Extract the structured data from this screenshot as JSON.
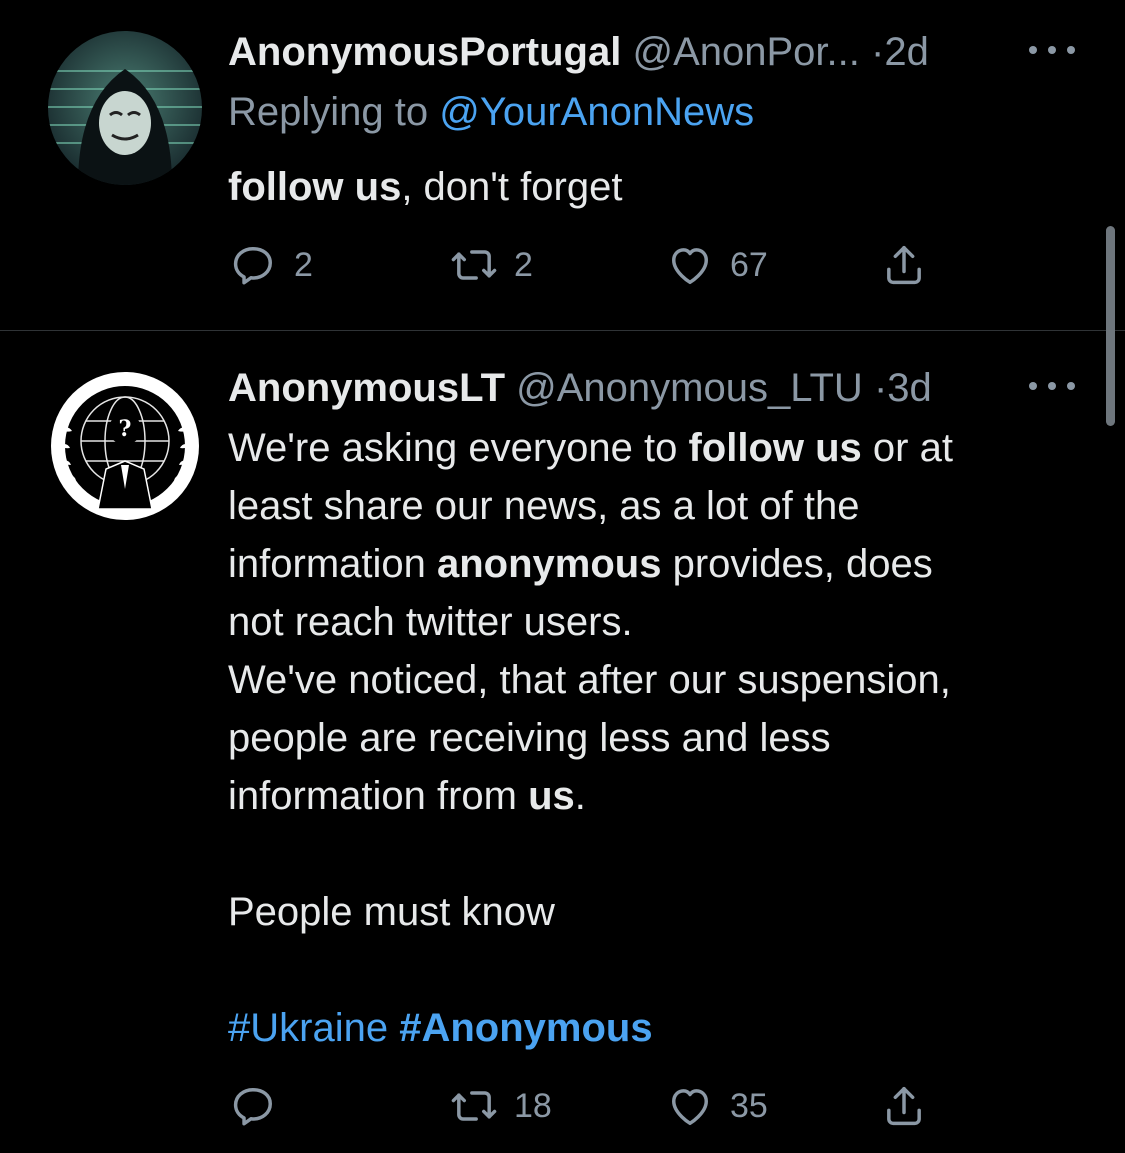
{
  "tweets": [
    {
      "name": "AnonymousPortugal",
      "handle": "@AnonPor...",
      "dot": "·",
      "time": "2d",
      "replying_prefix": "Replying to",
      "replying_to": "@YourAnonNews",
      "body_bold": "follow us",
      "body_rest": ", don't forget",
      "replies": "2",
      "retweets": "2",
      "likes": "67",
      "avatar_icon": "masked-figure-avatar"
    },
    {
      "name": "AnonymousLT",
      "handle": "@Anonymous_LTU",
      "dot": "·",
      "time": "3d",
      "lines": {
        "l1a": "We're asking everyone to ",
        "l1b": "follow us",
        "l1c": " or at",
        "l2": "least share our news, as a lot of the",
        "l3a": "information ",
        "l3b": "anonymous",
        "l3c": " provides, does",
        "l4": "not reach twitter users.",
        "l5": "We've noticed, that after our suspension,",
        "l6": "people are receiving less and less",
        "l7a": "information from ",
        "l7b": "us",
        "l7c": ".",
        "l8": "People must know",
        "tag1": "#Ukraine",
        "tag2": "#Anonymous"
      },
      "replies": "",
      "retweets": "18",
      "likes": "35",
      "avatar_icon": "anonymous-emblem-avatar"
    }
  ],
  "colors": {
    "background": "#000000",
    "text": "#e7e9ea",
    "muted": "#8b98a5",
    "link": "#4ba3f1",
    "divider": "#2f3336"
  }
}
